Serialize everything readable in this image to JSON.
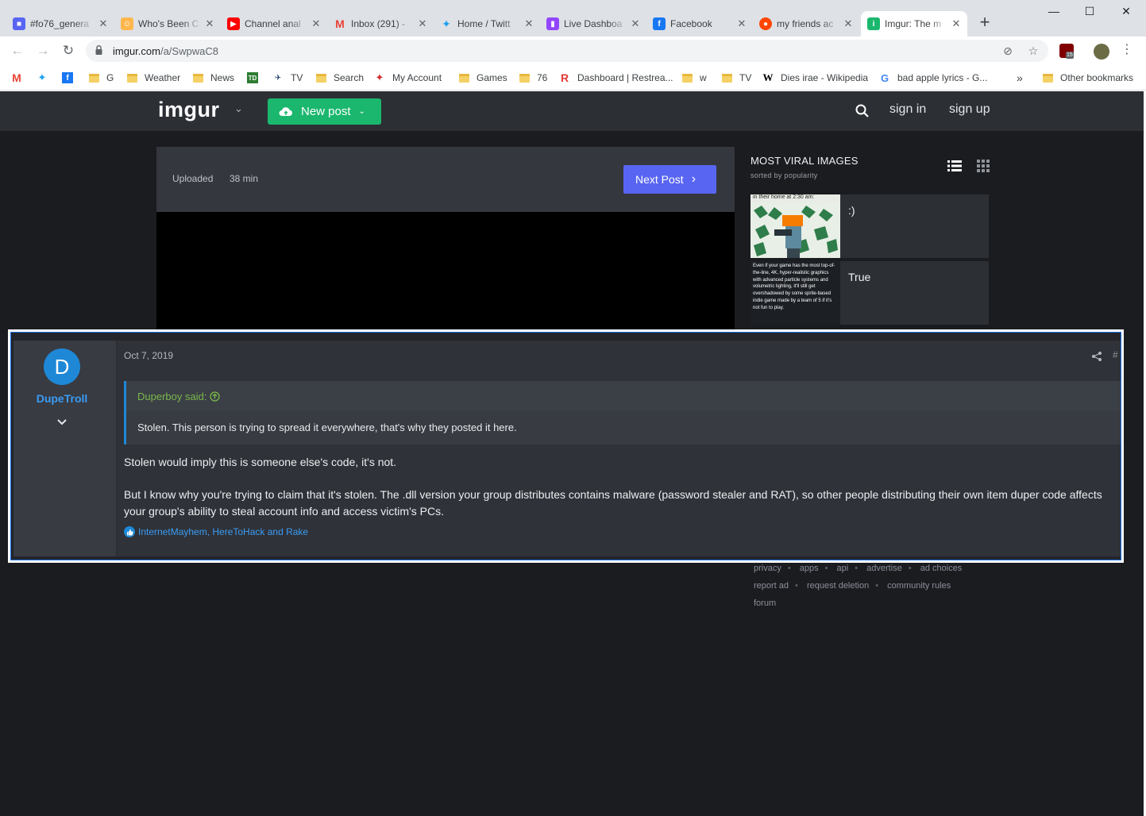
{
  "browser": {
    "tabs": [
      {
        "title": "#fo76_genera",
        "favicon": "discord",
        "color": "#5865f2",
        "active": false
      },
      {
        "title": "Who's Been C",
        "favicon": "clown",
        "color": "#ffb74d",
        "active": false
      },
      {
        "title": "Channel anal",
        "favicon": "youtube",
        "color": "#ff0000",
        "active": false
      },
      {
        "title": "Inbox (291) -",
        "favicon": "gmail",
        "color": "#ea4335",
        "active": false
      },
      {
        "title": "Home / Twitt",
        "favicon": "twitter",
        "color": "#1da1f2",
        "active": false
      },
      {
        "title": "Live Dashboa",
        "favicon": "twitch",
        "color": "#9146ff",
        "active": false
      },
      {
        "title": "Facebook",
        "favicon": "facebook",
        "color": "#1877f2",
        "active": false
      },
      {
        "title": "my friends ac",
        "favicon": "reddit",
        "color": "#ff4500",
        "active": false
      },
      {
        "title": "Imgur: The m",
        "favicon": "imgur",
        "color": "#1bb76e",
        "active": true
      }
    ],
    "new_tab": "+",
    "window_controls": {
      "minimize": "—",
      "maximize": "☐",
      "close": "✕"
    },
    "address": {
      "domain": "imgur.com",
      "path": "/a/SwpwaC8"
    },
    "extension_badge": "15",
    "bookmarks": [
      {
        "label": "",
        "icon": "gmail-icon"
      },
      {
        "label": "",
        "icon": "twitter-icon"
      },
      {
        "label": "",
        "icon": "facebook-icon"
      },
      {
        "label": "G",
        "icon": "folder-icon"
      },
      {
        "label": "Weather",
        "icon": "folder-icon"
      },
      {
        "label": "News",
        "icon": "folder-icon"
      },
      {
        "label": "TV",
        "icon": "td-icon"
      },
      {
        "label": "Search",
        "icon": "folder-icon"
      },
      {
        "label": "My Account",
        "icon": "maple-leaf-icon"
      },
      {
        "label": "Games",
        "icon": "folder-icon"
      },
      {
        "label": "76",
        "icon": "folder-icon"
      },
      {
        "label": "Dashboard | Restrea...",
        "icon": "restream-icon"
      },
      {
        "label": "w",
        "icon": "folder-icon"
      },
      {
        "label": "TV",
        "icon": "folder-icon"
      },
      {
        "label": "Dies irae - Wikipedia",
        "icon": "wikipedia-icon"
      },
      {
        "label": "bad apple lyrics - G...",
        "icon": "google-icon"
      }
    ],
    "more_bookmarks": "»",
    "other_bookmarks": "Other bookmarks"
  },
  "imgur": {
    "logo": "imgur",
    "new_post": "New post",
    "sign_in": "sign in",
    "sign_up": "sign up",
    "uploaded_label": "Uploaded",
    "uploaded_time": "38 min",
    "next_post": "Next Post",
    "viral_title": "MOST VIRAL IMAGES",
    "viral_subtitle": "sorted by popularity",
    "viral_items": [
      {
        "caption": ":)",
        "thumb_text": "in their home at 2:30 am:"
      },
      {
        "caption": "True",
        "thumb_text": "Even if your game has the most top-of-the-line, 4K, hyper-realistic graphics with advanced particle systems and volumetric lighting, it'll still get overshadowed by some sprite-based indie game made by a team of 5 if it's not fun to play."
      }
    ],
    "footer": {
      "row1": [
        "privacy",
        "apps",
        "api",
        "advertise",
        "ad choices"
      ],
      "row2": [
        "report ad",
        "request deletion",
        "community rules"
      ],
      "row3": [
        "forum"
      ]
    }
  },
  "forum_post": {
    "avatar_letter": "D",
    "username": "DupeTroll",
    "date": "Oct 7, 2019",
    "post_number": "#",
    "quote_author": "Duperboy said:",
    "quote_text": "Stolen. This person is trying to spread it everywhere, that's why they posted it here.",
    "paragraph1": "Stolen would imply this is someone else's code, it's not.",
    "paragraph2": "But I know why you're trying to claim that it's stolen. The .dll version your group distributes contains malware (password stealer and RAT), so other people distributing their own item duper code affects your group's ability to steal account info and access victim's PCs.",
    "reactions": "InternetMayhem, HereToHack and Rake"
  }
}
